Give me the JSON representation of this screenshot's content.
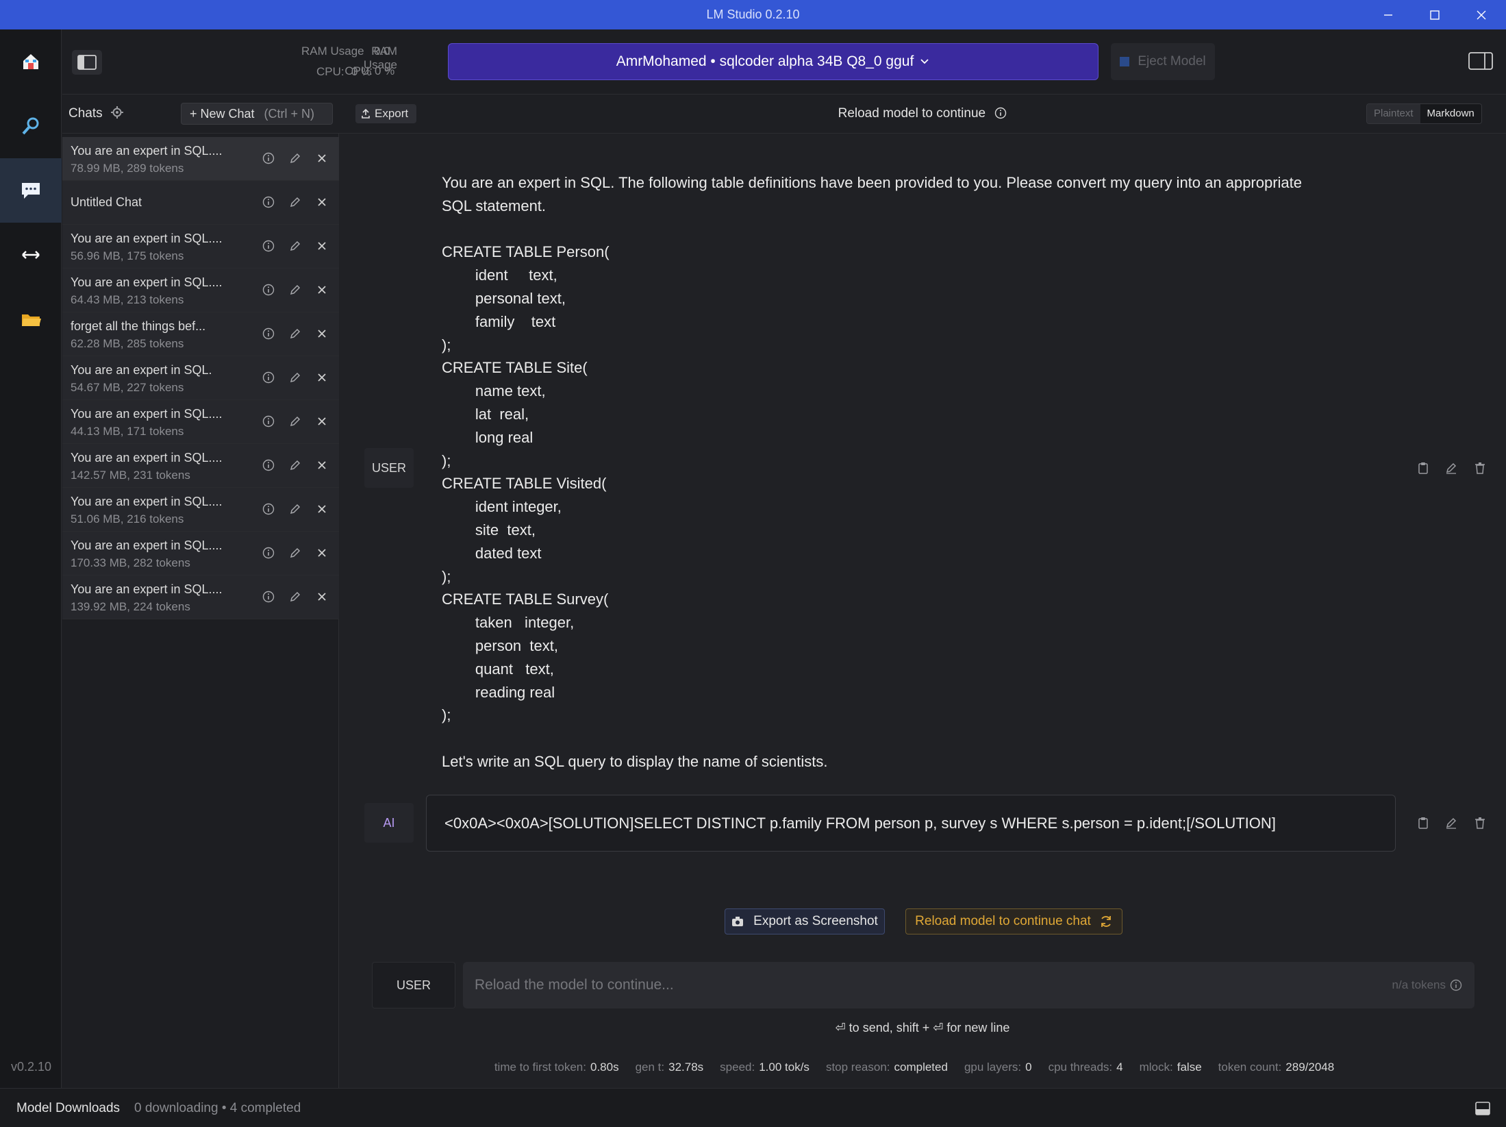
{
  "window": {
    "title": "LM Studio 0.2.10"
  },
  "rail": {
    "version": "v0.2.10"
  },
  "sidebar": {
    "chats_label": "Chats",
    "new_chat_label": "+ New Chat",
    "new_chat_shortcut": "(Ctrl + N)",
    "chats": [
      {
        "title": "You are an expert in SQL....",
        "meta": "78.99 MB, 289 tokens"
      },
      {
        "title": "Untitled Chat",
        "meta": ""
      },
      {
        "title": "You are an expert in SQL....",
        "meta": "56.96 MB, 175 tokens"
      },
      {
        "title": "You are an expert in SQL....",
        "meta": "64.43 MB, 213 tokens"
      },
      {
        "title": "forget all the things bef...",
        "meta": "62.28 MB, 285 tokens"
      },
      {
        "title": "You are an expert in SQL.",
        "meta": "54.67 MB, 227 tokens"
      },
      {
        "title": "You are an expert in SQL....",
        "meta": "44.13 MB, 171 tokens"
      },
      {
        "title": "You are an expert in SQL....",
        "meta": "142.57 MB, 231 tokens"
      },
      {
        "title": "You are an expert in SQL....",
        "meta": "51.06 MB, 216 tokens"
      },
      {
        "title": "You are an expert in SQL....",
        "meta": "170.33 MB, 282 tokens"
      },
      {
        "title": "You are an expert in SQL....",
        "meta": "139.92 MB, 224 tokens"
      }
    ]
  },
  "header": {
    "ram_label": "RAM Usage",
    "ram_value": "0.0",
    "cpu_label": "CPU:",
    "cpu_value": "0 %",
    "model_selector": "AmrMohamed • sqlcoder alpha 34B Q8_0 gguf",
    "eject_label": "Eject Model"
  },
  "subheader": {
    "export_label": "Export",
    "status": "Reload model to continue",
    "plaintext_label": "Plaintext",
    "markdown_label": "Markdown"
  },
  "messages": {
    "user_role": "USER",
    "user_lines": [
      "You are an expert in SQL. The following table definitions have been provided to you. Please convert my query into an appropriate",
      "SQL statement.",
      "",
      "CREATE TABLE Person(",
      "        ident     text,",
      "        personal text,",
      "        family    text",
      ");",
      "CREATE TABLE Site(",
      "        name text,",
      "        lat  real,",
      "        long real",
      ");",
      "CREATE TABLE Visited(",
      "        ident integer,",
      "        site  text,",
      "        dated text",
      ");",
      "CREATE TABLE Survey(",
      "        taken   integer,",
      "        person  text,",
      "        quant   text,",
      "        reading real",
      ");",
      "",
      "Let's write an SQL query to display the name of scientists."
    ],
    "ai_role": "AI",
    "ai_text": "<0x0A><0x0A>[SOLUTION]SELECT DISTINCT p.family FROM person p, survey s WHERE s.person = p.ident;[/SOLUTION]"
  },
  "actions": {
    "export_screenshot": "Export as Screenshot",
    "reload_chat": "Reload model to continue chat"
  },
  "composer": {
    "role": "USER",
    "placeholder": "Reload the model to continue...",
    "tokens": "n/a tokens",
    "hint": "⏎ to send, shift + ⏎ for new line"
  },
  "stats": {
    "ttft_label": "time to first token:",
    "ttft": "0.80s",
    "gen_label": "gen t:",
    "gen": "32.78s",
    "speed_label": "speed:",
    "speed": "1.00 tok/s",
    "stop_label": "stop reason:",
    "stop": "completed",
    "gpu_label": "gpu layers:",
    "gpu": "0",
    "cpu_label": "cpu threads:",
    "cpu": "4",
    "mlock_label": "mlock:",
    "mlock": "false",
    "tokens_label": "token count:",
    "tokens": "289/2048"
  },
  "footer": {
    "downloads_label": "Model Downloads",
    "downloads_status": "0 downloading • 4 completed"
  },
  "colors": {
    "titlebar": "#3457d5",
    "model_selector": "#3a2a9e",
    "reload_accent": "#e0a836"
  }
}
